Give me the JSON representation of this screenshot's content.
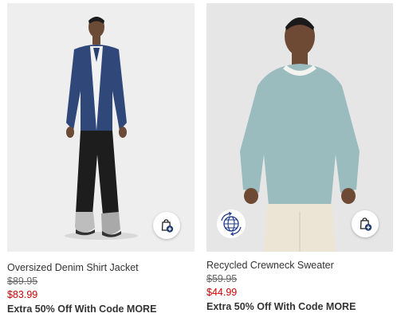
{
  "products": [
    {
      "name": "Oversized Denim Shirt Jacket",
      "original_price": "$89.95",
      "sale_price": "$83.99",
      "promo": "Extra 50% Off With Code MORE",
      "has_eco_badge": false,
      "bag_icon": "shopping-bag-plus-icon"
    },
    {
      "name": "Recycled Crewneck Sweater",
      "original_price": "$59.95",
      "sale_price": "$44.99",
      "promo": "Extra 50% Off With Code MORE",
      "has_eco_badge": true,
      "eco_icon": "globe-recycle-icon",
      "bag_icon": "shopping-bag-plus-icon"
    }
  ],
  "colors": {
    "sale_price": "#d00000",
    "bag_accent": "#1f3a6e",
    "eco_accent": "#1f3a8a"
  }
}
